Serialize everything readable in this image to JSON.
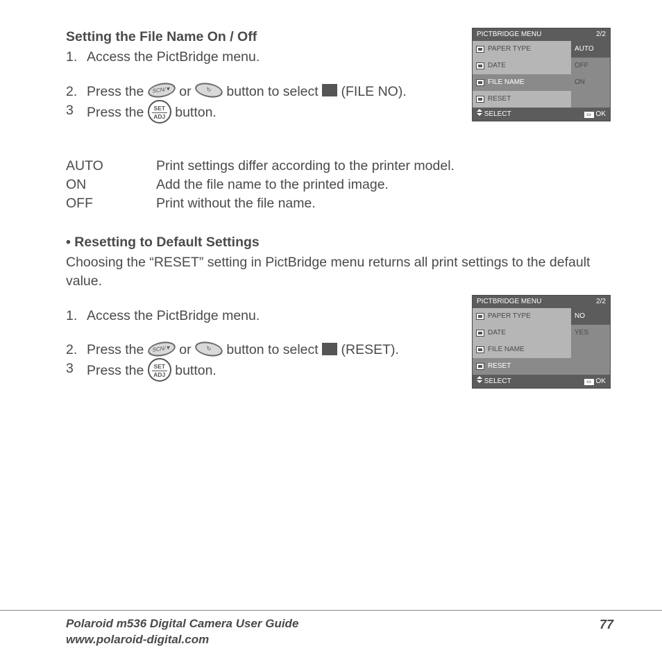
{
  "section1": {
    "title": "Setting the File Name On / Off",
    "steps": [
      {
        "num": "1.",
        "text": "Access the PictBridge menu."
      },
      {
        "num": "2.",
        "prefix": "Press the ",
        "mid": " or ",
        "suffix": " button to select ",
        "tail": " (FILE NO)."
      },
      {
        "num": "3",
        "prefix": "Press the ",
        "suffix": " button."
      }
    ]
  },
  "defs": [
    {
      "term": "AUTO",
      "desc": "Print settings differ according to the printer model."
    },
    {
      "term": "ON",
      "desc": "Add the file name to the printed image."
    },
    {
      "term": "OFF",
      "desc": "Print without the file name."
    }
  ],
  "section2": {
    "title": "Resetting to Default Settings",
    "intro": "Choosing the “RESET” setting in PictBridge menu returns all print settings to the default value.",
    "steps": [
      {
        "num": "1.",
        "text": "Access the PictBridge menu."
      },
      {
        "num": "2.",
        "prefix": "Press the ",
        "mid": " or ",
        "suffix": " button to select ",
        "tail": " (RESET)."
      },
      {
        "num": "3",
        "prefix": "Press the ",
        "suffix": " button."
      }
    ]
  },
  "lcd1": {
    "header_left": "PICTBRIDGE MENU",
    "header_right": "2/2",
    "left_items": [
      "PAPER TYPE",
      "DATE",
      "FILE NAME",
      "RESET"
    ],
    "right_items": [
      "AUTO",
      "OFF",
      "ON"
    ],
    "left_selected_index": 2,
    "right_selected_index": 0,
    "footer_left": "SELECT",
    "footer_right": "OK"
  },
  "lcd2": {
    "header_left": "PICTBRIDGE MENU",
    "header_right": "2/2",
    "left_items": [
      "PAPER TYPE",
      "DATE",
      "FILE NAME",
      "RESET"
    ],
    "right_items": [
      "NO",
      "YES"
    ],
    "left_selected_index": 3,
    "right_selected_index": 0,
    "footer_left": "SELECT",
    "footer_right": "OK"
  },
  "buttons": {
    "scn_m": "SCN/▼",
    "flash": "↻",
    "set": "SET",
    "adj": "ADJ"
  },
  "footer": {
    "line1": "Polaroid m536 Digital Camera User Guide",
    "line2": "www.polaroid-digital.com",
    "page": "77"
  }
}
